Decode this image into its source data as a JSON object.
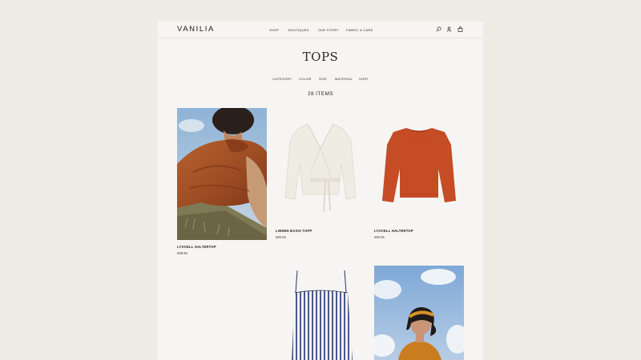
{
  "brand": {
    "logo": "VANILIA"
  },
  "nav": [
    "SHOP",
    "BOUTIQUES",
    "OUR STORY",
    "FABRIC & CARE"
  ],
  "header_icons": [
    "search-icon",
    "account-icon",
    "bag-icon"
  ],
  "page": {
    "title": "TOPS",
    "filters": [
      "CATEGORY",
      "COLOR",
      "SIZE",
      "MATERIAL",
      "SORT"
    ],
    "item_count": "28 ITEMS"
  },
  "products": [
    {
      "name": "LYOCELL HALTERTOP",
      "price": "€89.95"
    },
    {
      "name": "LINNEN BASIS TOPP",
      "price": "€89.95"
    },
    {
      "name": "LYOCELL HALTERTOP",
      "price": "€89.95"
    }
  ],
  "colors": {
    "background": "#efece6",
    "page": "#f6f5f3",
    "text": "#1e1e1e",
    "rust": "#a8542a",
    "orange": "#c8502b",
    "sky": "#9fbcd8"
  }
}
